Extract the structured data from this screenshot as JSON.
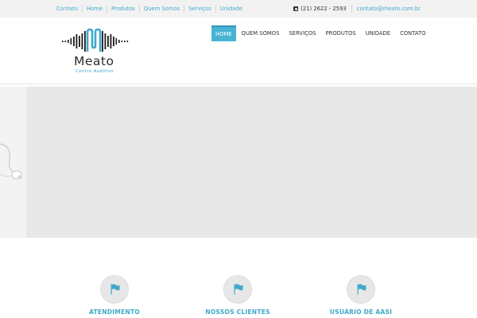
{
  "topbar": {
    "links": [
      "Contato",
      "Home",
      "Produtos",
      "Quem Somos",
      "Serviços",
      "Unidade"
    ],
    "phone_icon": "phone-square-icon",
    "phone": "(21) 2622 - 2593",
    "email": "contato@meato.com.br"
  },
  "brand": {
    "name": "Meato",
    "tagline": "Centro Auditivo",
    "logo_icon": "sound-wave-logo-icon"
  },
  "nav": {
    "items": [
      "HOME",
      "QUEM SOMOS",
      "SERVIÇOS",
      "PRODUTOS",
      "UNIDADE",
      "CONTATO"
    ],
    "active_index": 0
  },
  "hero": {
    "image_icon": "hearing-aid-icon"
  },
  "features": [
    {
      "icon": "flag-icon",
      "title": "ATENDIMENTO"
    },
    {
      "icon": "flag-icon",
      "title": "NOSSOS CLIENTES"
    },
    {
      "icon": "flag-icon",
      "title": "USUÁRIO DE AASI"
    }
  ],
  "colors": {
    "accent": "#48b3d3",
    "link": "#3fa9c9",
    "topbar_bg": "#f2f2f2",
    "slider_bg": "#e8e8e8"
  }
}
